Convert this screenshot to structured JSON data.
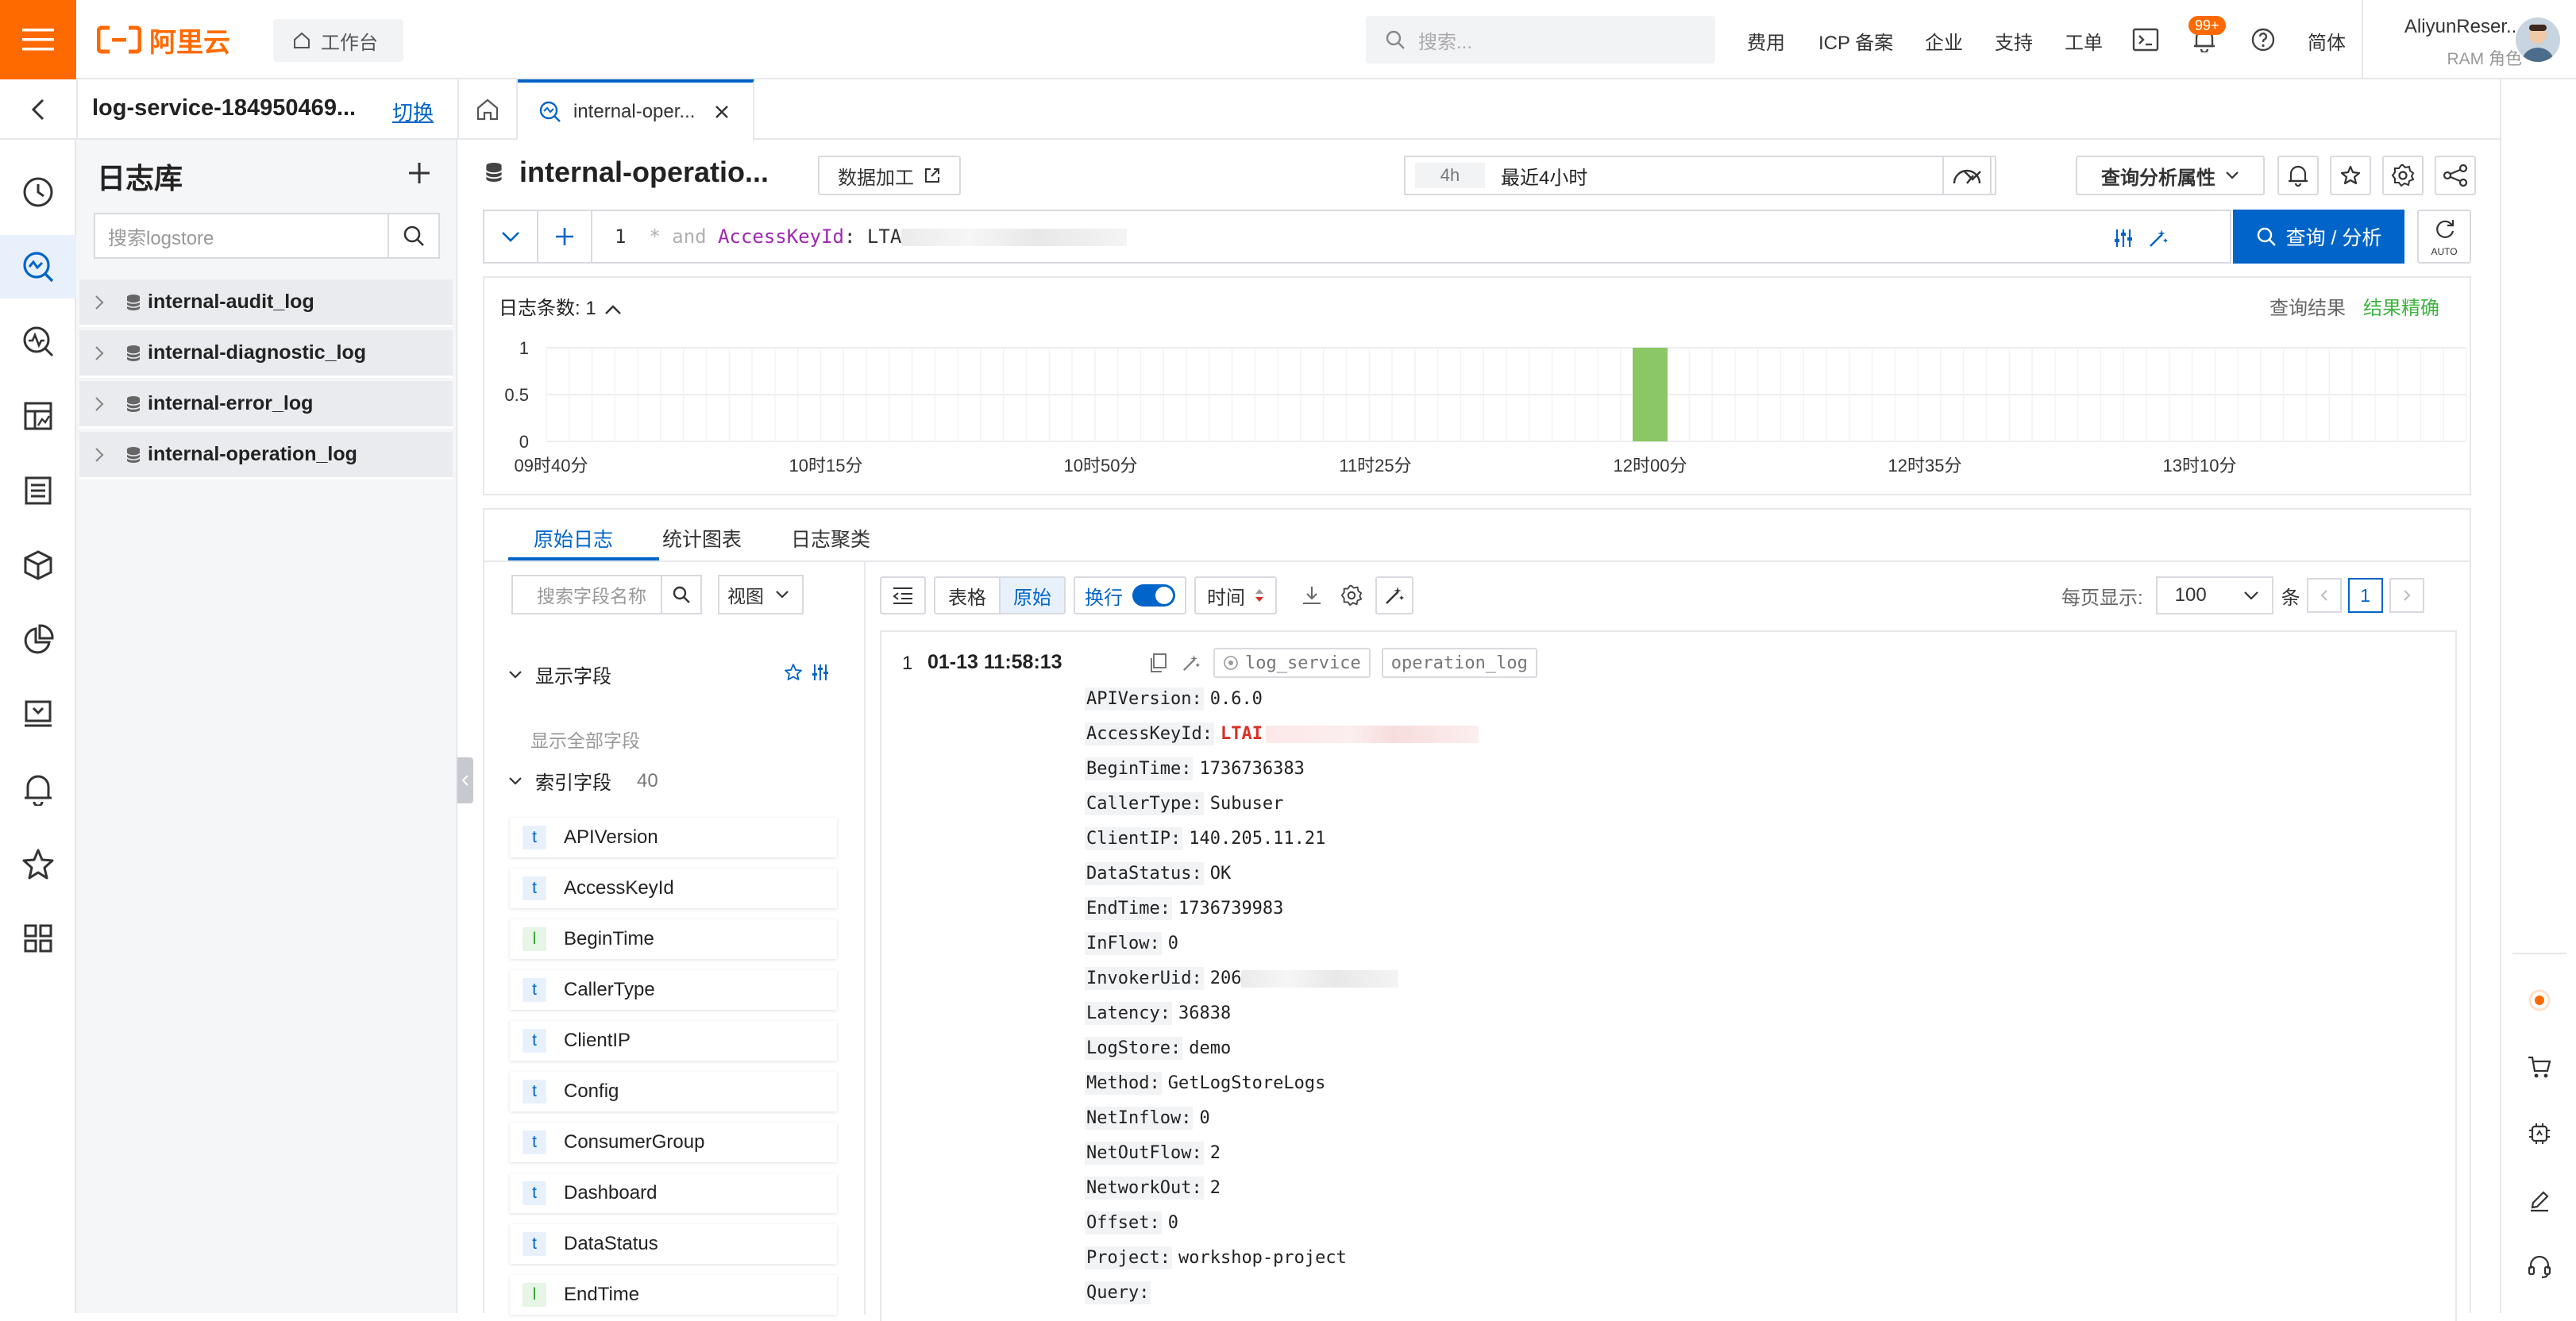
{
  "topbar": {
    "logo_text": "阿里云",
    "workspace_label": "工作台",
    "search_placeholder": "搜索...",
    "nav": [
      "费用",
      "ICP 备案",
      "企业",
      "支持",
      "工单"
    ],
    "notif_badge": "99+",
    "lang": "简体",
    "user_name": "AliyunReser...",
    "user_role": "RAM 角色",
    "accent": "#ff6a00"
  },
  "project_bar": {
    "project_name": "log-service-184950469...",
    "switch_label": "切换",
    "active_tab_label": "internal-oper..."
  },
  "iconbar": [
    "clock-icon",
    "log-search-icon",
    "monitor-icon",
    "dashboard-icon",
    "report-icon",
    "package-icon",
    "pie-icon",
    "data-icon",
    "bell-icon",
    "star-icon",
    "grid-icon"
  ],
  "logstore_panel": {
    "title": "日志库",
    "search_placeholder": "搜索logstore",
    "items": [
      "internal-audit_log",
      "internal-diagnostic_log",
      "internal-error_log",
      "internal-operation_log"
    ]
  },
  "main": {
    "logstore_title": "internal-operatio...",
    "data_processing_label": "数据加工",
    "time_badge": "4h",
    "time_value": "最近4小时",
    "query_props_label": "查询分析属性",
    "query": {
      "line_no": "1",
      "part1": "* and ",
      "key": "AccessKeyId",
      "part2": ": LTA"
    },
    "submit_label": "查询 / 分析",
    "auto_label": "AUTO",
    "primary": "#0064c8"
  },
  "histogram": {
    "count_label": "日志条数: 1",
    "result_label": "查询结果",
    "accurate_label": "结果精确",
    "y_ticks": [
      "1",
      "0.5",
      "0"
    ],
    "x_ticks": [
      "09时40分",
      "10时15分",
      "10时50分",
      "11时25分",
      "12时00分",
      "12时35分",
      "13时10分"
    ]
  },
  "chart_data": {
    "type": "bar",
    "title": "",
    "x": [
      "12时00分"
    ],
    "values": [
      1
    ],
    "ylim": [
      0,
      1
    ],
    "bar_color": "#8bc865",
    "grid": true
  },
  "log_tabs": [
    "原始日志",
    "统计图表",
    "日志聚类"
  ],
  "fields": {
    "search_placeholder": "搜索字段名称",
    "view_label": "视图",
    "shown_title": "显示字段",
    "show_all_label": "显示全部字段",
    "indexed_title": "索引字段",
    "indexed_count": "40",
    "items": [
      {
        "type": "t",
        "name": "APIVersion"
      },
      {
        "type": "t",
        "name": "AccessKeyId"
      },
      {
        "type": "l",
        "name": "BeginTime"
      },
      {
        "type": "t",
        "name": "CallerType"
      },
      {
        "type": "t",
        "name": "ClientIP"
      },
      {
        "type": "t",
        "name": "Config"
      },
      {
        "type": "t",
        "name": "ConsumerGroup"
      },
      {
        "type": "t",
        "name": "Dashboard"
      },
      {
        "type": "t",
        "name": "DataStatus"
      },
      {
        "type": "l",
        "name": "EndTime"
      }
    ]
  },
  "log_toolbar": {
    "table_label": "表格",
    "raw_label": "原始",
    "wrap_label": "换行",
    "time_sort_label": "时间",
    "per_page_label": "每页显示:",
    "per_page_value": "100",
    "unit_label": "条",
    "page": "1"
  },
  "log_entry": {
    "index": "1",
    "time": "01-13 11:58:13",
    "tags": [
      "log_service",
      "operation_log"
    ],
    "fields": [
      {
        "k": "APIVersion:",
        "v": "0.6.0"
      },
      {
        "k": "AccessKeyId:",
        "v": "LTAI",
        "red": true
      },
      {
        "k": "BeginTime:",
        "v": "1736736383"
      },
      {
        "k": "CallerType:",
        "v": "Subuser"
      },
      {
        "k": "ClientIP:",
        "v": "140.205.11.21"
      },
      {
        "k": "DataStatus:",
        "v": "OK"
      },
      {
        "k": "EndTime:",
        "v": "1736739983"
      },
      {
        "k": "InFlow:",
        "v": "0"
      },
      {
        "k": "InvokerUid:",
        "v": "206"
      },
      {
        "k": "Latency:",
        "v": "36838"
      },
      {
        "k": "LogStore:",
        "v": "demo"
      },
      {
        "k": "Method:",
        "v": "GetLogStoreLogs"
      },
      {
        "k": "NetInflow:",
        "v": "0"
      },
      {
        "k": "NetOutFlow:",
        "v": "2"
      },
      {
        "k": "NetworkOut:",
        "v": "2"
      },
      {
        "k": "Offset:",
        "v": "0"
      },
      {
        "k": "Project:",
        "v": "workshop-project"
      },
      {
        "k": "Query:",
        "v": ""
      }
    ]
  }
}
